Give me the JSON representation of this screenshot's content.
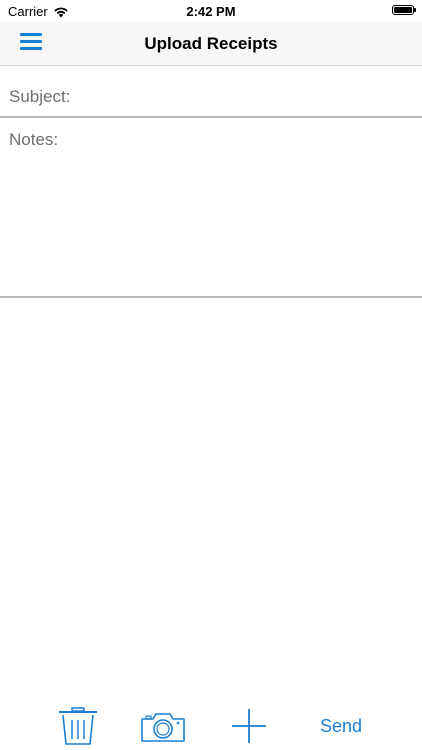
{
  "status_bar": {
    "carrier": "Carrier",
    "time": "2:42 PM"
  },
  "nav": {
    "title": "Upload Receipts",
    "menu_icon": "hamburger-menu-icon"
  },
  "form": {
    "subject_placeholder": "Subject:",
    "notes_placeholder": "Notes:"
  },
  "toolbar": {
    "icons": [
      "trash-icon",
      "camera-icon",
      "plus-icon"
    ],
    "send_label": "Send"
  },
  "colors": {
    "accent": "#1a7fd4",
    "placeholder": "#6d6d72",
    "divider": "#b9b9b9"
  }
}
